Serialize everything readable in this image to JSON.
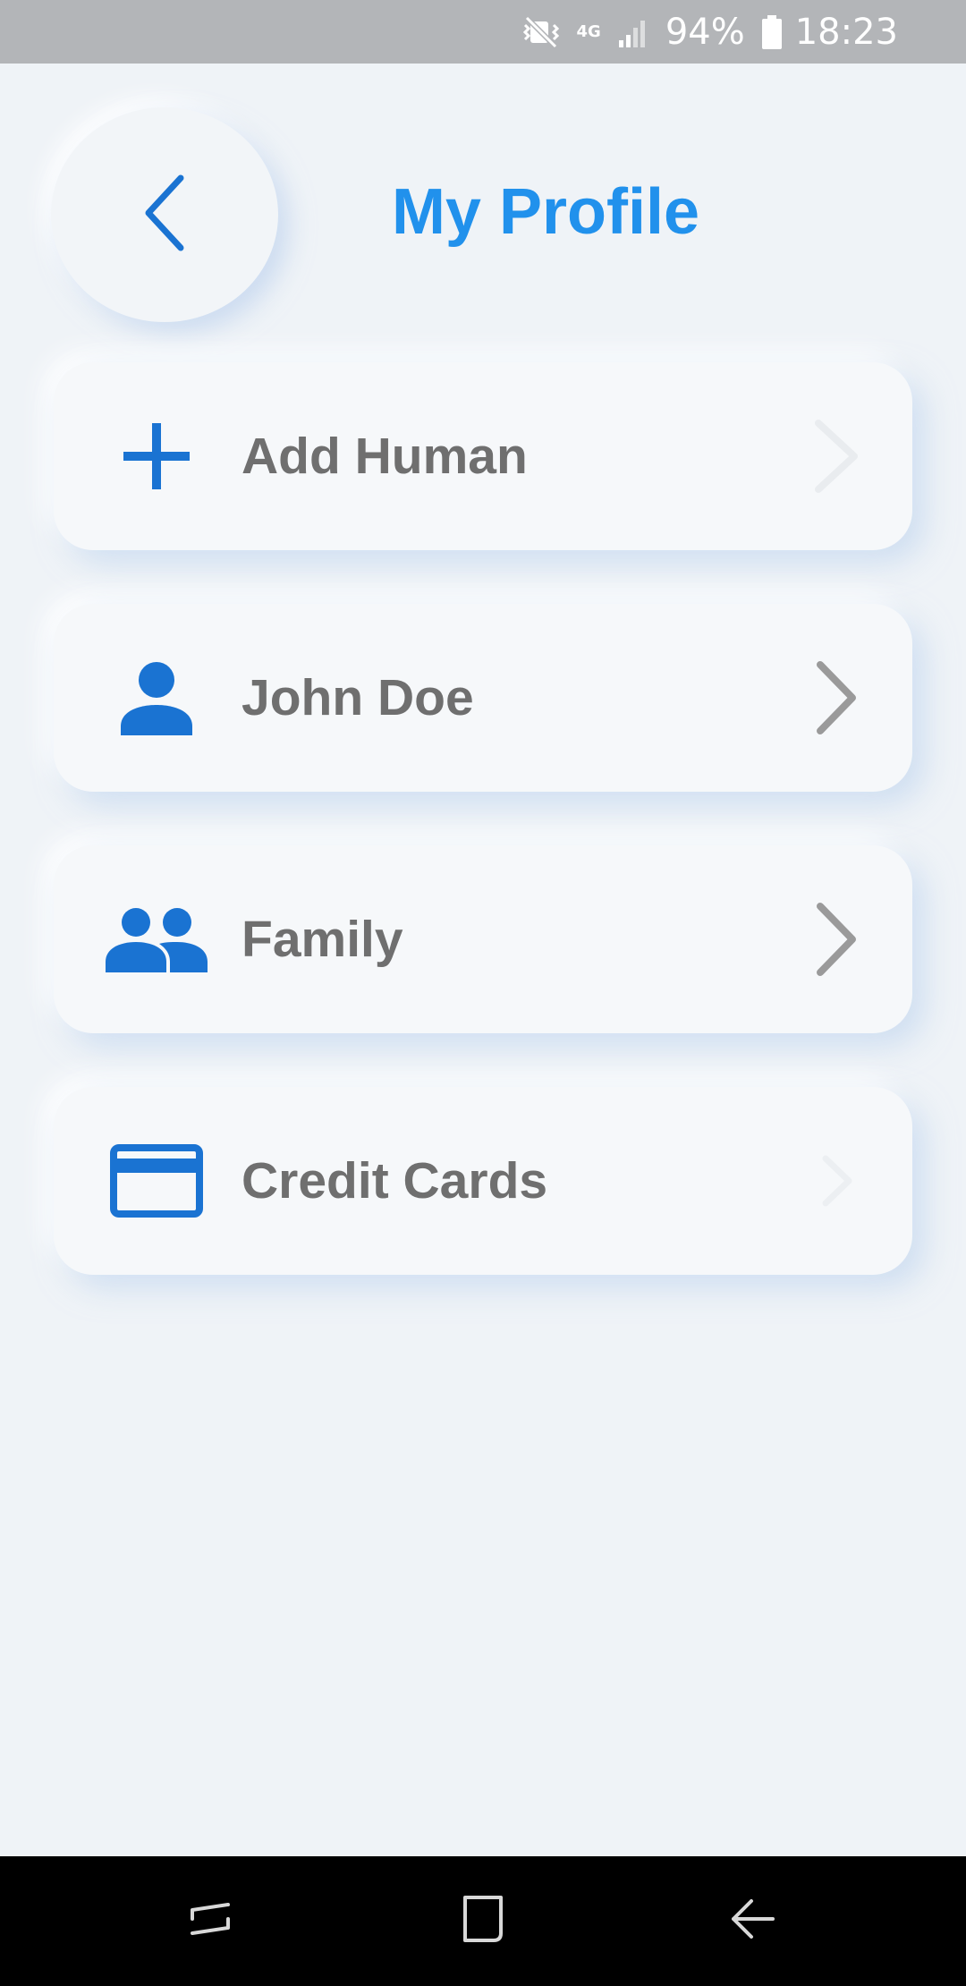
{
  "status_bar": {
    "mute_icon": "vibrate-mute-icon",
    "network_label": "4G",
    "signal_icon": "signal-bars-icon",
    "battery_percent": "94%",
    "battery_icon": "battery-icon",
    "time": "18:23"
  },
  "header": {
    "back_icon": "chevron-left-icon",
    "title": "My Profile"
  },
  "menu": {
    "items": [
      {
        "label": "Add Human",
        "icon": "plus-icon"
      },
      {
        "label": "John Doe",
        "icon": "person-icon"
      },
      {
        "label": "Family",
        "icon": "people-icon"
      },
      {
        "label": "Credit Cards",
        "icon": "credit-card-icon"
      }
    ]
  },
  "nav_bar": {
    "recents_icon": "recents-icon",
    "home_icon": "home-icon",
    "back_icon": "back-arrow-icon"
  },
  "colors": {
    "accent": "#2191ec",
    "icon_blue": "#1a73d2",
    "label_gray": "#6f6f6f",
    "background": "#eff3f7",
    "status_bar": "#b3b5b8",
    "nav_bar": "#000000"
  }
}
